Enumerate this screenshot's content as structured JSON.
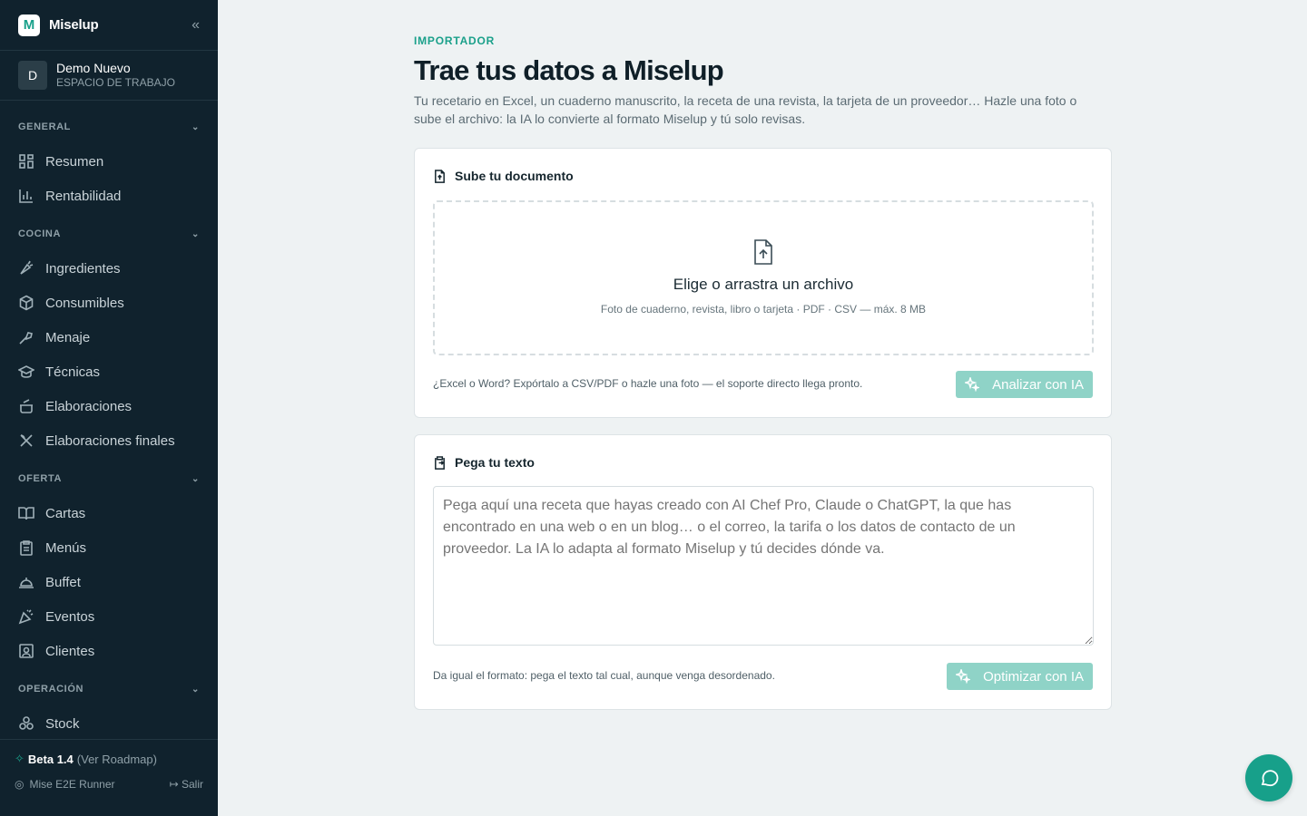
{
  "brand": {
    "logo_letter": "M",
    "name": "Miselup",
    "collapse_glyph": "«"
  },
  "workspace": {
    "initial": "D",
    "name": "Demo Nuevo",
    "subtitle": "ESPACIO DE TRABAJO"
  },
  "sidebar": {
    "sections": [
      {
        "label": "GENERAL",
        "items": [
          {
            "label": "Resumen",
            "icon": "grid-icon"
          },
          {
            "label": "Rentabilidad",
            "icon": "bar-chart-icon"
          }
        ]
      },
      {
        "label": "COCINA",
        "items": [
          {
            "label": "Ingredientes",
            "icon": "carrot-icon"
          },
          {
            "label": "Consumibles",
            "icon": "package-icon"
          },
          {
            "label": "Menaje",
            "icon": "tools-icon"
          },
          {
            "label": "Técnicas",
            "icon": "graduation-cap-icon"
          },
          {
            "label": "Elaboraciones",
            "icon": "cooking-pot-icon"
          },
          {
            "label": "Elaboraciones finales",
            "icon": "utensils-crossed-icon"
          }
        ]
      },
      {
        "label": "OFERTA",
        "items": [
          {
            "label": "Cartas",
            "icon": "book-open-icon"
          },
          {
            "label": "Menús",
            "icon": "clipboard-list-icon"
          },
          {
            "label": "Buffet",
            "icon": "cloche-icon"
          },
          {
            "label": "Eventos",
            "icon": "party-popper-icon"
          },
          {
            "label": "Clientes",
            "icon": "contact-icon"
          }
        ]
      },
      {
        "label": "OPERACIÓN",
        "items": [
          {
            "label": "Stock",
            "icon": "boxes-icon"
          }
        ]
      }
    ]
  },
  "footer": {
    "beta_label": "Beta 1.4",
    "roadmap_label": "(Ver Roadmap)",
    "user_name": "Mise E2E Runner",
    "logout_label": "Salir"
  },
  "page": {
    "eyebrow": "IMPORTADOR",
    "title": "Trae tus datos a Miselup",
    "subtitle": "Tu recetario en Excel, un cuaderno manuscrito, la receta de una revista, la tarjeta de un proveedor… Hazle una foto o sube el archivo: la IA lo convierte al formato Miselup y tú solo revisas."
  },
  "upload_card": {
    "title": "Sube tu documento",
    "dropzone_title": "Elige o arrastra un archivo",
    "dropzone_hint": "Foto de cuaderno, revista, libro o tarjeta · PDF · CSV — máx. 8 MB",
    "note": "¿Excel o Word? Expórtalo a CSV/PDF o hazle una foto — el soporte directo llega pronto.",
    "button_label": "Analizar con IA"
  },
  "text_card": {
    "title": "Pega tu texto",
    "placeholder": "Pega aquí una receta que hayas creado con AI Chef Pro, Claude o ChatGPT, la que has encontrado en una web o en un blog… o el correo, la tarifa o los datos de contacto de un proveedor. La IA lo adapta al formato Miselup y tú decides dónde va.",
    "note": "Da igual el formato: pega el texto tal cual, aunque venga desordenado.",
    "button_label": "Optimizar con IA"
  },
  "colors": {
    "sidebar_bg": "#10222d",
    "accent": "#1aa08a",
    "button_disabled": "#8fd3c7",
    "page_bg": "#eef2f3"
  }
}
